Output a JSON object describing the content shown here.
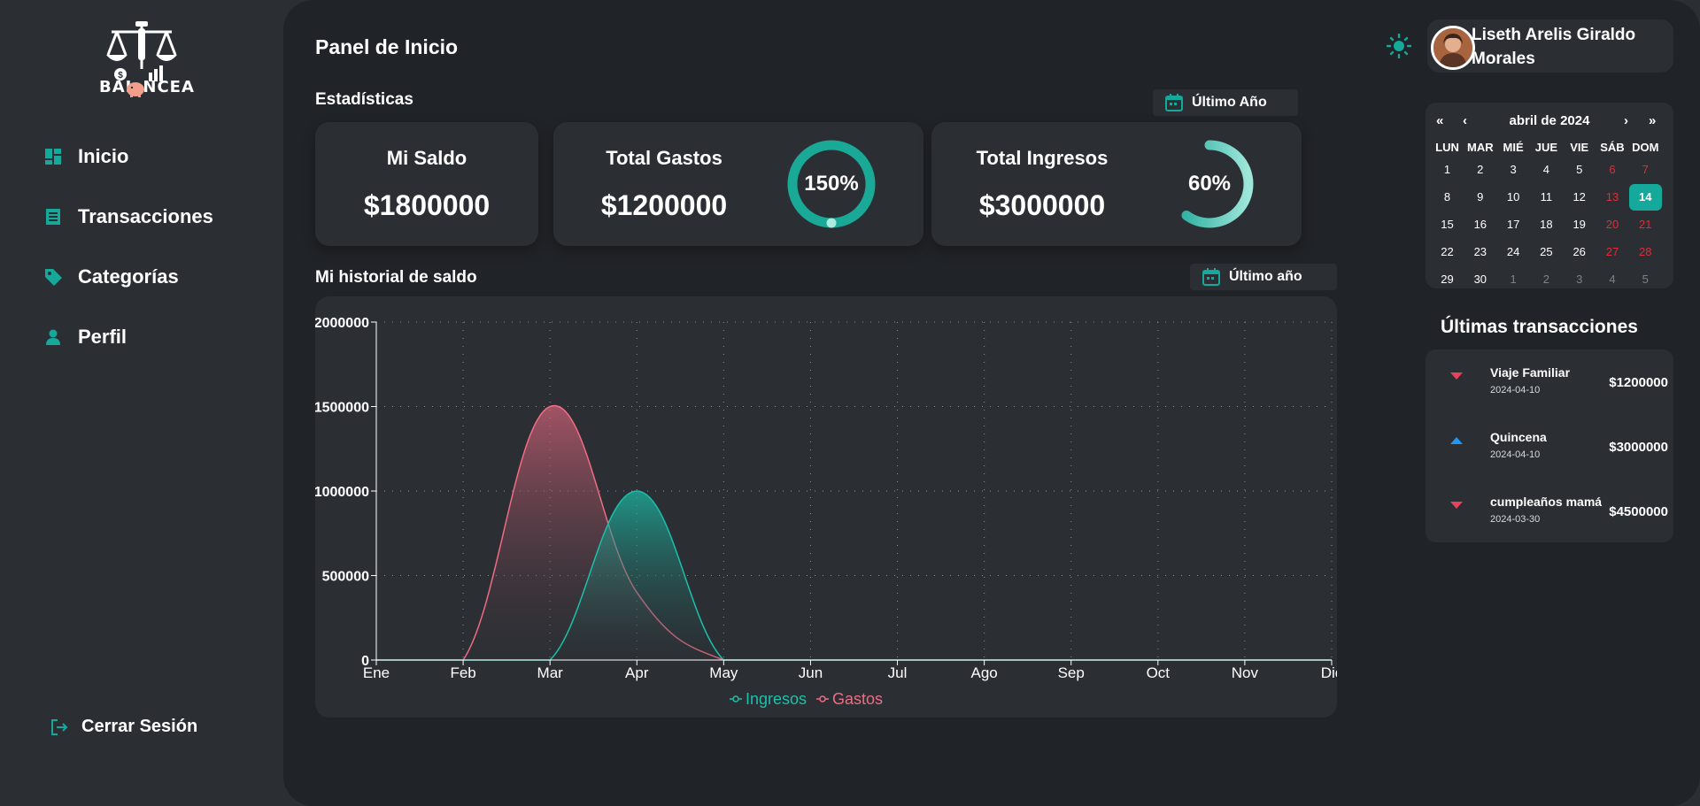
{
  "brand": {
    "logo_text": "BAL NCEA"
  },
  "nav": {
    "items": [
      {
        "label": "Inicio",
        "icon": "dashboard-icon"
      },
      {
        "label": "Transacciones",
        "icon": "receipt-icon"
      },
      {
        "label": "Categorías",
        "icon": "tag-icon"
      },
      {
        "label": "Perfil",
        "icon": "person-icon"
      }
    ],
    "logout_label": "Cerrar Sesión"
  },
  "header": {
    "title": "Panel de Inicio"
  },
  "stats": {
    "title": "Estadísticas",
    "range_label": "Último Año",
    "cards": [
      {
        "title": "Mi Saldo",
        "value": "$1800000"
      },
      {
        "title": "Total Gastos",
        "value": "$1200000",
        "ring_label": "150%",
        "ring_fraction": 1.0
      },
      {
        "title": "Total Ingresos",
        "value": "$3000000",
        "ring_label": "60%",
        "ring_fraction": 0.6
      }
    ]
  },
  "history": {
    "title": "Mi historial de saldo",
    "range_label": "Último año"
  },
  "colors": {
    "accent": "#14a99a",
    "ingresos": "#1bc0aa",
    "gastos": "#f06b84",
    "expense_arrow": "#e8415a",
    "income_arrow": "#2196f3"
  },
  "chart_data": {
    "type": "area",
    "categories": [
      "Ene",
      "Feb",
      "Mar",
      "Apr",
      "May",
      "Jun",
      "Jul",
      "Ago",
      "Sep",
      "Oct",
      "Nov",
      "Dic"
    ],
    "y_ticks": [
      "0",
      "500000",
      "1000000",
      "1500000",
      "2000000"
    ],
    "ylim": [
      0,
      2000000
    ],
    "series": [
      {
        "name": "Ingresos",
        "values": [
          0,
          0,
          0,
          1000000,
          0,
          0,
          0,
          0,
          0,
          0,
          0,
          0
        ],
        "color": "#1bc0aa"
      },
      {
        "name": "Gastos",
        "values": [
          0,
          0,
          1500000,
          400000,
          0,
          0,
          0,
          0,
          0,
          0,
          0,
          0
        ],
        "color": "#f06b84"
      }
    ],
    "grid": true,
    "legend": "bottom"
  },
  "user": {
    "name": "Liseth Arelis Giraldo Morales"
  },
  "calendar": {
    "month_label": "abril de 2024",
    "prev_year": "«",
    "prev_month": "‹",
    "next_month": "›",
    "next_year": "»",
    "days_of_week": [
      "LUN",
      "MAR",
      "MIÉ",
      "JUE",
      "VIE",
      "SÁB",
      "DOM"
    ],
    "weeks": [
      [
        "1",
        "2",
        "3",
        "4",
        "5",
        "6",
        "7"
      ],
      [
        "8",
        "9",
        "10",
        "11",
        "12",
        "13",
        "14"
      ],
      [
        "15",
        "16",
        "17",
        "18",
        "19",
        "20",
        "21"
      ],
      [
        "22",
        "23",
        "24",
        "25",
        "26",
        "27",
        "28"
      ],
      [
        "29",
        "30",
        "1",
        "2",
        "3",
        "4",
        "5"
      ]
    ],
    "selected_day": "14"
  },
  "transactions": {
    "title": "Últimas transacciones",
    "items": [
      {
        "name": "Viaje Familiar",
        "date": "2024-04-10",
        "amount": "$1200000",
        "type": "expense"
      },
      {
        "name": "Quincena",
        "date": "2024-04-10",
        "amount": "$3000000",
        "type": "income"
      },
      {
        "name": "cumpleaños mamá",
        "date": "2024-03-30",
        "amount": "$4500000",
        "type": "expense"
      }
    ]
  }
}
